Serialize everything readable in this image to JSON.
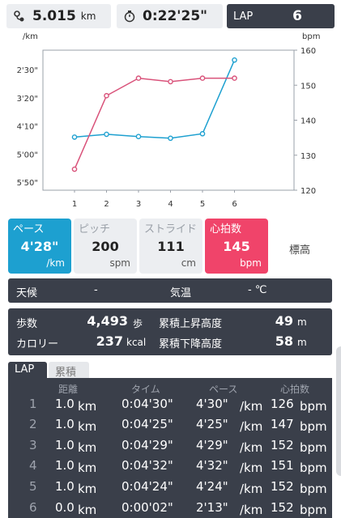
{
  "topbar": {
    "distance_value": "5.015",
    "distance_unit": "km",
    "time_value": "0:22'25\"",
    "lap_label": "LAP",
    "lap_value": "6",
    "distance_icon": "route-icon",
    "time_icon": "stopwatch-icon"
  },
  "chart_data": {
    "type": "line",
    "x": [
      1,
      2,
      3,
      4,
      5,
      6
    ],
    "ylabel_left": "/km",
    "ylabel_right": "bpm",
    "left_ticks": [
      "2'30\"",
      "3'20\"",
      "4'10\"",
      "5'00\"",
      "5'50\""
    ],
    "right_ticks": [
      "160",
      "150",
      "140",
      "130",
      "120"
    ],
    "pace_axis_seconds": {
      "top": 150,
      "bottom": 350
    },
    "ylim_right": [
      120,
      160
    ],
    "series": [
      {
        "name_hidden": "pace",
        "axis": "left",
        "color": "#1da0d0",
        "values_seconds": [
          270,
          265,
          269,
          272,
          264,
          133
        ]
      },
      {
        "name_hidden": "heart_rate",
        "axis": "right",
        "color": "#d9527a",
        "values": [
          126,
          147,
          152,
          151,
          152,
          152
        ]
      }
    ]
  },
  "metrics": {
    "pace": {
      "label": "ペース",
      "value": "4'28\"",
      "unit": "/km"
    },
    "pitch": {
      "label": "ピッチ",
      "value": "200",
      "unit": "spm"
    },
    "stride": {
      "label": "ストライド",
      "value": "111",
      "unit": "cm"
    },
    "heart": {
      "label": "心拍数",
      "value": "145",
      "unit": "bpm"
    },
    "elevation": {
      "label": "標高"
    }
  },
  "weather": {
    "weather_label": "天候",
    "weather_value": "-",
    "temp_label": "気温",
    "temp_value": "- ℃"
  },
  "stats": {
    "steps_label": "歩数",
    "steps_value": "4,493",
    "steps_unit": "歩",
    "cal_label": "カロリー",
    "cal_value": "237",
    "cal_unit": "kcal",
    "ascent_label": "累積上昇高度",
    "ascent_value": "49",
    "ascent_unit": "m",
    "descent_label": "累積下降高度",
    "descent_value": "58",
    "descent_unit": "m"
  },
  "tabs": {
    "lap": "LAP",
    "total": "累積"
  },
  "laps": {
    "headers": [
      "距離",
      "タイム",
      "ペース",
      "心拍数"
    ],
    "rows": [
      {
        "idx": "1",
        "dist": "1.0",
        "dist_unit": "km",
        "time": "0:04'30\"",
        "pace": "4'30\"",
        "pace_unit": "/km",
        "hr": "126",
        "hr_unit": "bpm"
      },
      {
        "idx": "2",
        "dist": "1.0",
        "dist_unit": "km",
        "time": "0:04'25\"",
        "pace": "4'25\"",
        "pace_unit": "/km",
        "hr": "147",
        "hr_unit": "bpm"
      },
      {
        "idx": "3",
        "dist": "1.0",
        "dist_unit": "km",
        "time": "0:04'29\"",
        "pace": "4'29\"",
        "pace_unit": "/km",
        "hr": "152",
        "hr_unit": "bpm"
      },
      {
        "idx": "4",
        "dist": "1.0",
        "dist_unit": "km",
        "time": "0:04'32\"",
        "pace": "4'32\"",
        "pace_unit": "/km",
        "hr": "151",
        "hr_unit": "bpm"
      },
      {
        "idx": "5",
        "dist": "1.0",
        "dist_unit": "km",
        "time": "0:04'24\"",
        "pace": "4'24\"",
        "pace_unit": "/km",
        "hr": "152",
        "hr_unit": "bpm"
      },
      {
        "idx": "6",
        "dist": "0.0",
        "dist_unit": "km",
        "time": "0:00'02\"",
        "pace": "2'13\"",
        "pace_unit": "/km",
        "hr": "152",
        "hr_unit": "bpm"
      }
    ]
  }
}
